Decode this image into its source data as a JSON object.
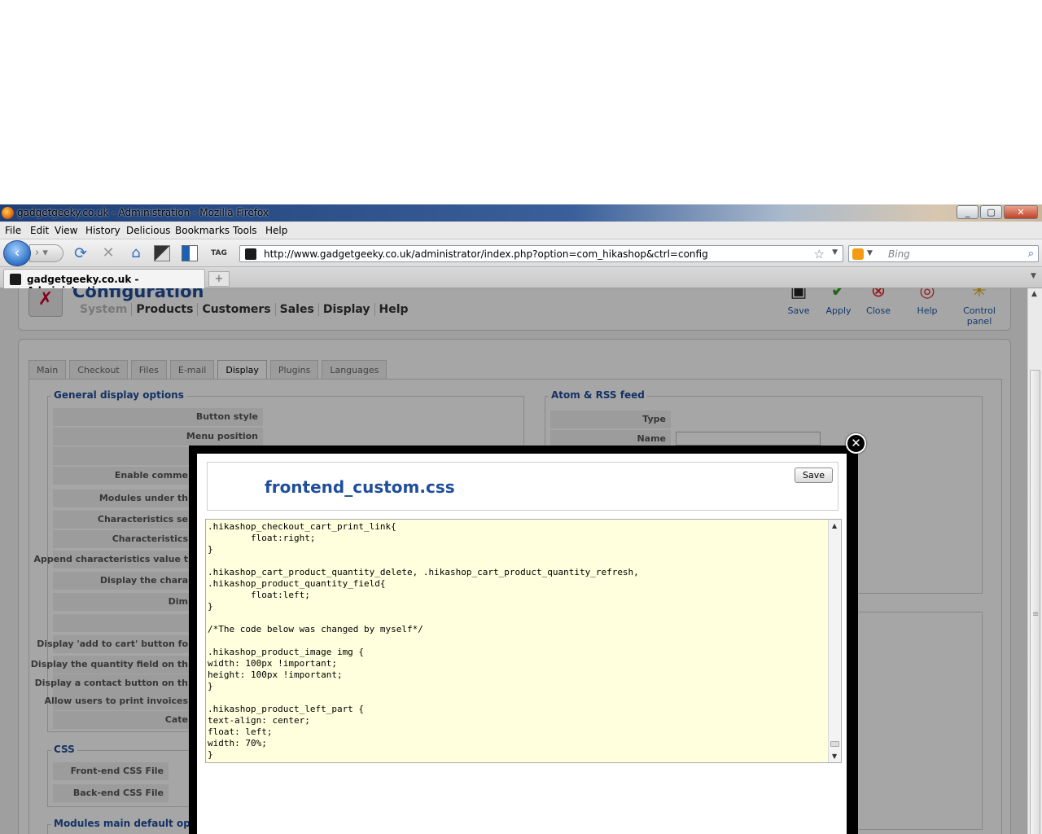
{
  "window": {
    "title": "gadgetgeeky.co.uk - Administration - Mozilla Firefox",
    "min": "_",
    "max": "▢",
    "close": "✕"
  },
  "menu": [
    "File",
    "Edit",
    "View",
    "History",
    "Delicious",
    "Bookmarks",
    "Tools",
    "Help"
  ],
  "nav": {
    "url": "http://www.gadgetgeeky.co.uk/administrator/index.php?option=com_hikashop&ctrl=config",
    "search_placeholder": "Bing"
  },
  "tab": {
    "label": "gadgetgeeky.co.uk - Administration",
    "new": "+"
  },
  "page": {
    "title": "Configuration",
    "subnav": [
      "System",
      "Products",
      "Customers",
      "Sales",
      "Display",
      "Help"
    ],
    "toolbar": [
      "Save",
      "Apply",
      "Close",
      "Help",
      "Control panel"
    ],
    "tabs": [
      "Main",
      "Checkout",
      "Files",
      "E-mail",
      "Display",
      "Plugins",
      "Languages"
    ],
    "general": {
      "legend": "General display options",
      "rows": [
        "Button style",
        "Menu position",
        "",
        "Enable comme",
        "Modules under th",
        "Characteristics se",
        "Characteristics",
        "Append characteristics value t",
        "Display the chara",
        "Dim",
        "",
        "Display 'add to cart' button fo",
        "Display the quantity field on th",
        "Display a contact button on th",
        "Allow users to print invoices",
        "Cate"
      ]
    },
    "feed": {
      "legend": "Atom & RSS feed",
      "rows": [
        "Type",
        "Name"
      ]
    },
    "css": {
      "legend": "CSS",
      "rows": [
        "Front-end CSS File",
        "Back-end CSS File"
      ]
    },
    "modules": {
      "legend": "Modules main default options"
    }
  },
  "modal": {
    "title": "frontend_custom.css",
    "save": "Save",
    "close": "✕",
    "code": ".hikashop_checkout_cart_print_link{\n        float:right;\n}\n\n.hikashop_cart_product_quantity_delete, .hikashop_cart_product_quantity_refresh,\n.hikashop_product_quantity_field{\n        float:left;\n}\n\n/*The code below was changed by myself*/\n\n.hikashop_product_image img {\nwidth: 100px !important;\nheight: 100px !important;\n}\n\n.hikashop_product_left_part {\ntext-align: center;\nfloat: left;\nwidth: 70%;\n}"
  }
}
